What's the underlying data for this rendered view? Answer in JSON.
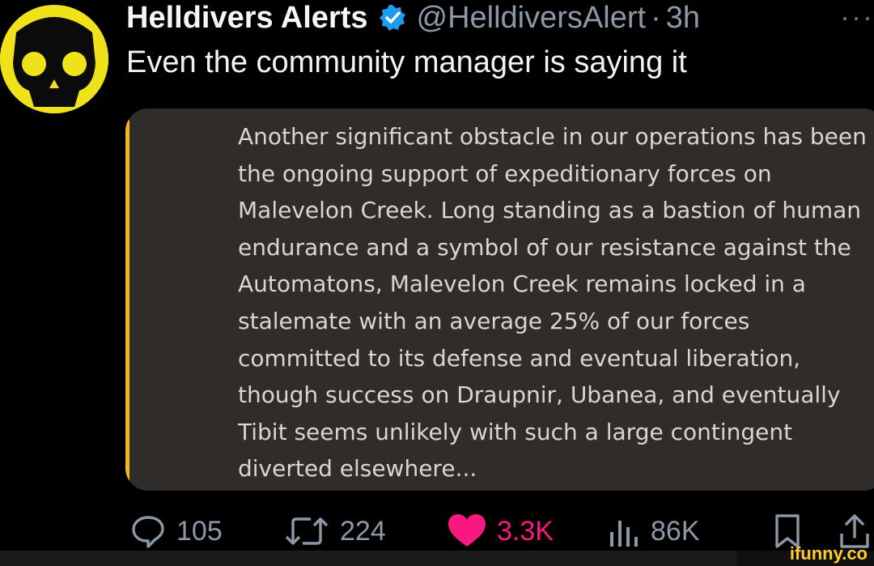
{
  "author": {
    "name": "Helldivers Alerts",
    "handle": "@HelldiversAlert",
    "separator": "·",
    "time": "3h",
    "verified_icon": "verified-badge-icon",
    "avatar_color": "#f0e21a"
  },
  "more_label": "···",
  "tweet": {
    "text": "Even the community manager is saying it"
  },
  "quote": {
    "accent_color": "#f2b81f",
    "text": "Another significant obstacle in our operations has been the ongoing support of expeditionary forces on Malevelon Creek. Long standing as a bastion of human endurance and a symbol of our resistance against the Automatons, Malevelon Creek remains locked in a stalemate with an average 25% of our forces committed to its defense and eventual liberation, though success on Draupnir, Ubanea, and eventually Tibit seems unlikely with such a large contingent diverted elsewhere..."
  },
  "actions": {
    "replies": "105",
    "reposts": "224",
    "likes": "3.3K",
    "views": "86K",
    "like_color": "#f91880"
  },
  "watermark": "ifunny.co"
}
